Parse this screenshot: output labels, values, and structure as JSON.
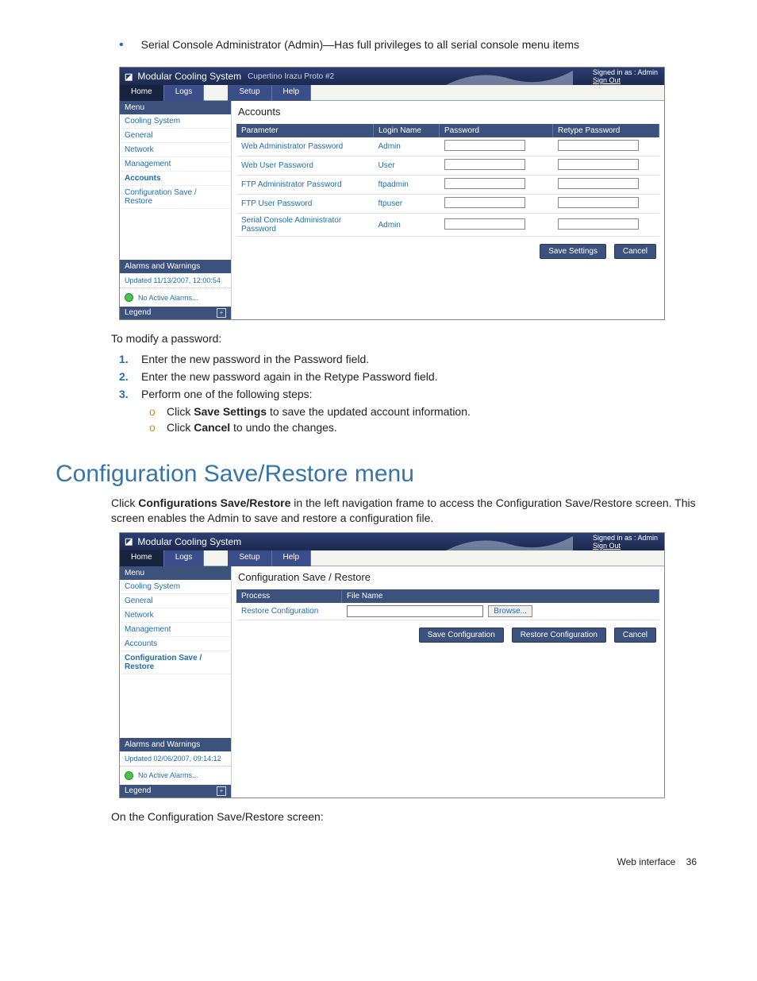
{
  "intro_bullet": "Serial Console Administrator (Admin)—Has full privileges to all serial console menu items",
  "shot1": {
    "product": "Modular Cooling System",
    "subtitle": "Cupertino Irazu Proto #2",
    "signed_in": "Signed in as : Admin",
    "sign_out": "Sign Out",
    "tabs": {
      "home": "Home",
      "logs": "Logs",
      "setup": "Setup",
      "help": "Help"
    },
    "menu_hdr": "Menu",
    "menu": [
      "Cooling System",
      "General",
      "Network",
      "Management",
      "Accounts",
      "Configuration Save / Restore"
    ],
    "menu_selected_index": 4,
    "alarms_hdr": "Alarms and Warnings",
    "updated": "Updated 11/13/2007, 12:00:54",
    "no_alarms": "No Active Alarms...",
    "legend": "Legend",
    "page_title": "Accounts",
    "columns": {
      "param": "Parameter",
      "login": "Login Name",
      "pwd": "Password",
      "retype": "Retype Password"
    },
    "rows": [
      {
        "param": "Web Administrator Password",
        "login": "Admin"
      },
      {
        "param": "Web User Password",
        "login": "User"
      },
      {
        "param": "FTP Administrator Password",
        "login": "ftpadmin"
      },
      {
        "param": "FTP User Password",
        "login": "ftpuser"
      },
      {
        "param": "Serial Console Administrator Password",
        "login": "Admin"
      }
    ],
    "save_btn": "Save Settings",
    "cancel_btn": "Cancel"
  },
  "modify_intro": "To modify a password:",
  "steps": [
    "Enter the new password in the Password field.",
    "Enter the new password again in the Retype Password field.",
    "Perform one of the following steps:"
  ],
  "sub_a_pre": "Click ",
  "sub_a_bold": "Save Settings",
  "sub_a_post": " to save the updated account information.",
  "sub_b_pre": "Click ",
  "sub_b_bold": "Cancel",
  "sub_b_post": " to undo the changes.",
  "section_heading": "Configuration Save/Restore menu",
  "section_p_pre": "Click ",
  "section_p_bold": "Configurations Save/Restore",
  "section_p_post": " in the left navigation frame to access the Configuration Save/Restore screen. This screen enables the Admin to save and restore a configuration file.",
  "shot2": {
    "product": "Modular Cooling System",
    "signed_in": "Signed in as : Admin",
    "sign_out": "Sign Out",
    "tabs": {
      "home": "Home",
      "logs": "Logs",
      "setup": "Setup",
      "help": "Help"
    },
    "menu_hdr": "Menu",
    "menu": [
      "Cooling System",
      "General",
      "Network",
      "Management",
      "Accounts",
      "Configuration Save / Restore"
    ],
    "menu_selected_index": 5,
    "alarms_hdr": "Alarms and Warnings",
    "updated": "Updated 02/06/2007, 09:14:12",
    "no_alarms": "No Active Alarms...",
    "legend": "Legend",
    "page_title": "Configuration Save / Restore",
    "col_process": "Process",
    "col_file": "File Name",
    "row_label": "Restore Configuration",
    "browse": "Browse...",
    "btn_save": "Save Configuration",
    "btn_restore": "Restore Configuration",
    "btn_cancel": "Cancel"
  },
  "after_shot2": "On the Configuration Save/Restore screen:",
  "footer_label": "Web interface",
  "footer_page": "36"
}
